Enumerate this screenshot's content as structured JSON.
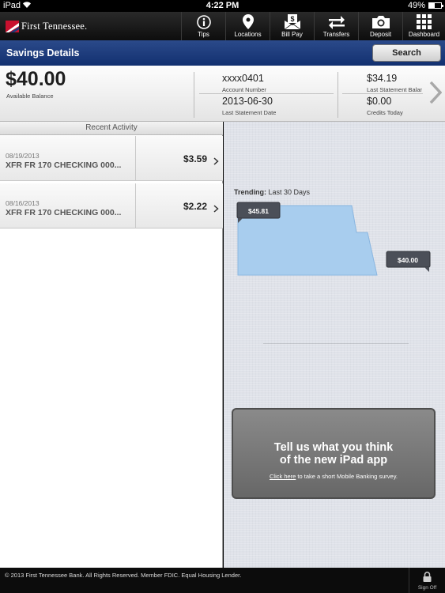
{
  "status_bar": {
    "carrier": "iPad",
    "time": "4:22 PM",
    "battery": "49%"
  },
  "brand": {
    "name": "First Tennessee."
  },
  "nav": [
    {
      "label": "Tips",
      "icon": "info-icon"
    },
    {
      "label": "Locations",
      "icon": "map-pin-icon"
    },
    {
      "label": "Bill Pay",
      "icon": "bill-envelope-icon"
    },
    {
      "label": "Transfers",
      "icon": "transfer-arrows-icon"
    },
    {
      "label": "Deposit",
      "icon": "camera-icon"
    },
    {
      "label": "Dashboard",
      "icon": "grid-icon"
    }
  ],
  "header": {
    "title": "Savings Details",
    "search_label": "Search"
  },
  "summary": {
    "available_balance": "$40.00",
    "available_label": "Available Balance",
    "account_number": "xxxx0401",
    "account_number_label": "Account Number",
    "statement_date": "2013-06-30",
    "statement_date_label": "Last Statement Date",
    "last_statement_balance": "$34.19",
    "last_statement_balance_label": "Last Statement Balance",
    "credits_today": "$0.00",
    "credits_today_label": "Credits Today"
  },
  "recent_activity": {
    "title": "Recent Activity",
    "items": [
      {
        "date": "08/19/2013",
        "description": "XFR FR 170 CHECKING 000...",
        "amount": "$3.59"
      },
      {
        "date": "08/16/2013",
        "description": "XFR FR 170 CHECKING 000...",
        "amount": "$2.22"
      }
    ]
  },
  "trending": {
    "label_bold": "Trending:",
    "label_rest": "Last 30 Days",
    "start_value": "$45.81",
    "end_value": "$40.00"
  },
  "survey": {
    "line1": "Tell us what you think",
    "line2": "of the new iPad app",
    "link_text": "Click here",
    "rest_text": " to take a short Mobile Banking survey."
  },
  "footer": {
    "legal": "© 2013 First Tennessee Bank. All Rights Reserved. Member FDIC. Equal Housing Lender.",
    "sign_off": "Sign Off"
  },
  "colors": {
    "header_blue": "#1a3a7c",
    "chart_fill": "#a8cdee"
  }
}
